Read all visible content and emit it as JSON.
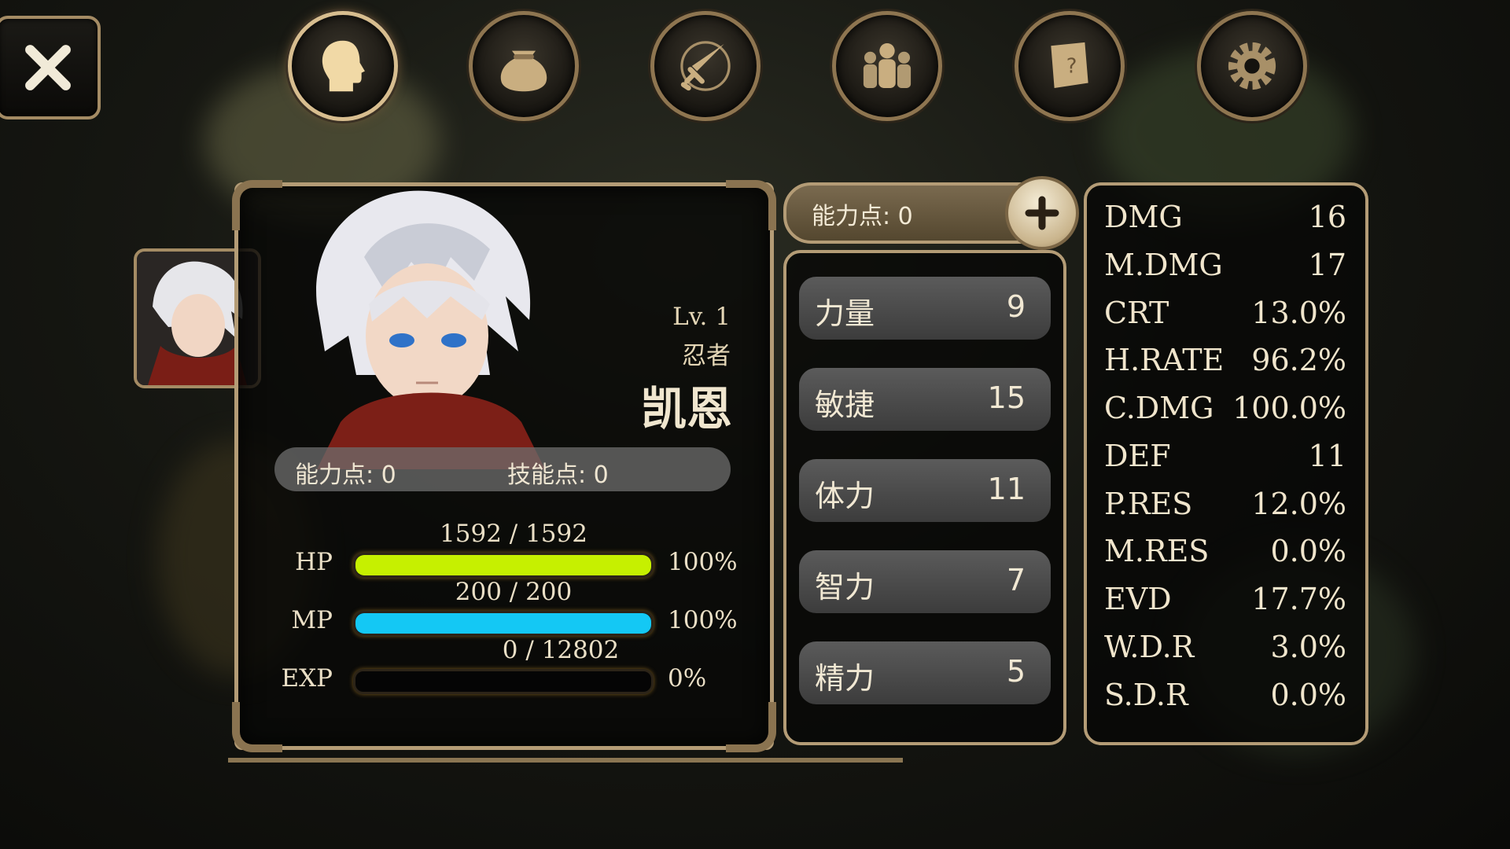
{
  "top_menu": {
    "close_icon": "close-icon",
    "buttons": [
      {
        "icon": "character-head-icon",
        "active": true
      },
      {
        "icon": "inventory-bag-icon",
        "active": false
      },
      {
        "icon": "skills-sword-compass-icon",
        "active": false
      },
      {
        "icon": "party-people-icon",
        "active": false
      },
      {
        "icon": "quest-scroll-icon",
        "active": false
      },
      {
        "icon": "settings-gear-icon",
        "active": false
      }
    ]
  },
  "character": {
    "level": "Lv. 1",
    "class": "忍者",
    "name": "凯恩",
    "ability_points": "能力点: 0",
    "skill_points": "技能点: 0",
    "hp": {
      "label": "HP",
      "value": "1592 / 1592",
      "percent": "100%",
      "fill": 1.0,
      "color": "#c6f000"
    },
    "mp": {
      "label": "MP",
      "value": "200 / 200",
      "percent": "100%",
      "fill": 1.0,
      "color": "#14c8f4"
    },
    "exp": {
      "label": "EXP",
      "value": "0 / 12802",
      "percent": "0%",
      "fill": 0.0,
      "color": "#e0b020"
    }
  },
  "attributes": {
    "header": "能力点: 0",
    "rows": [
      {
        "name": "力量",
        "value": "9"
      },
      {
        "name": "敏捷",
        "value": "15"
      },
      {
        "name": "体力",
        "value": "11"
      },
      {
        "name": "智力",
        "value": "7"
      },
      {
        "name": "精力",
        "value": "5"
      }
    ]
  },
  "stats": [
    {
      "name": "DMG",
      "value": "16"
    },
    {
      "name": "M.DMG",
      "value": "17"
    },
    {
      "name": "CRT",
      "value": "13.0%"
    },
    {
      "name": "H.RATE",
      "value": "96.2%"
    },
    {
      "name": "C.DMG",
      "value": "100.0%"
    },
    {
      "name": "DEF",
      "value": "11"
    },
    {
      "name": "P.RES",
      "value": "12.0%"
    },
    {
      "name": "M.RES",
      "value": "0.0%"
    },
    {
      "name": "EVD",
      "value": "17.7%"
    },
    {
      "name": "W.D.R",
      "value": "3.0%"
    },
    {
      "name": "S.D.R",
      "value": "0.0%"
    }
  ]
}
